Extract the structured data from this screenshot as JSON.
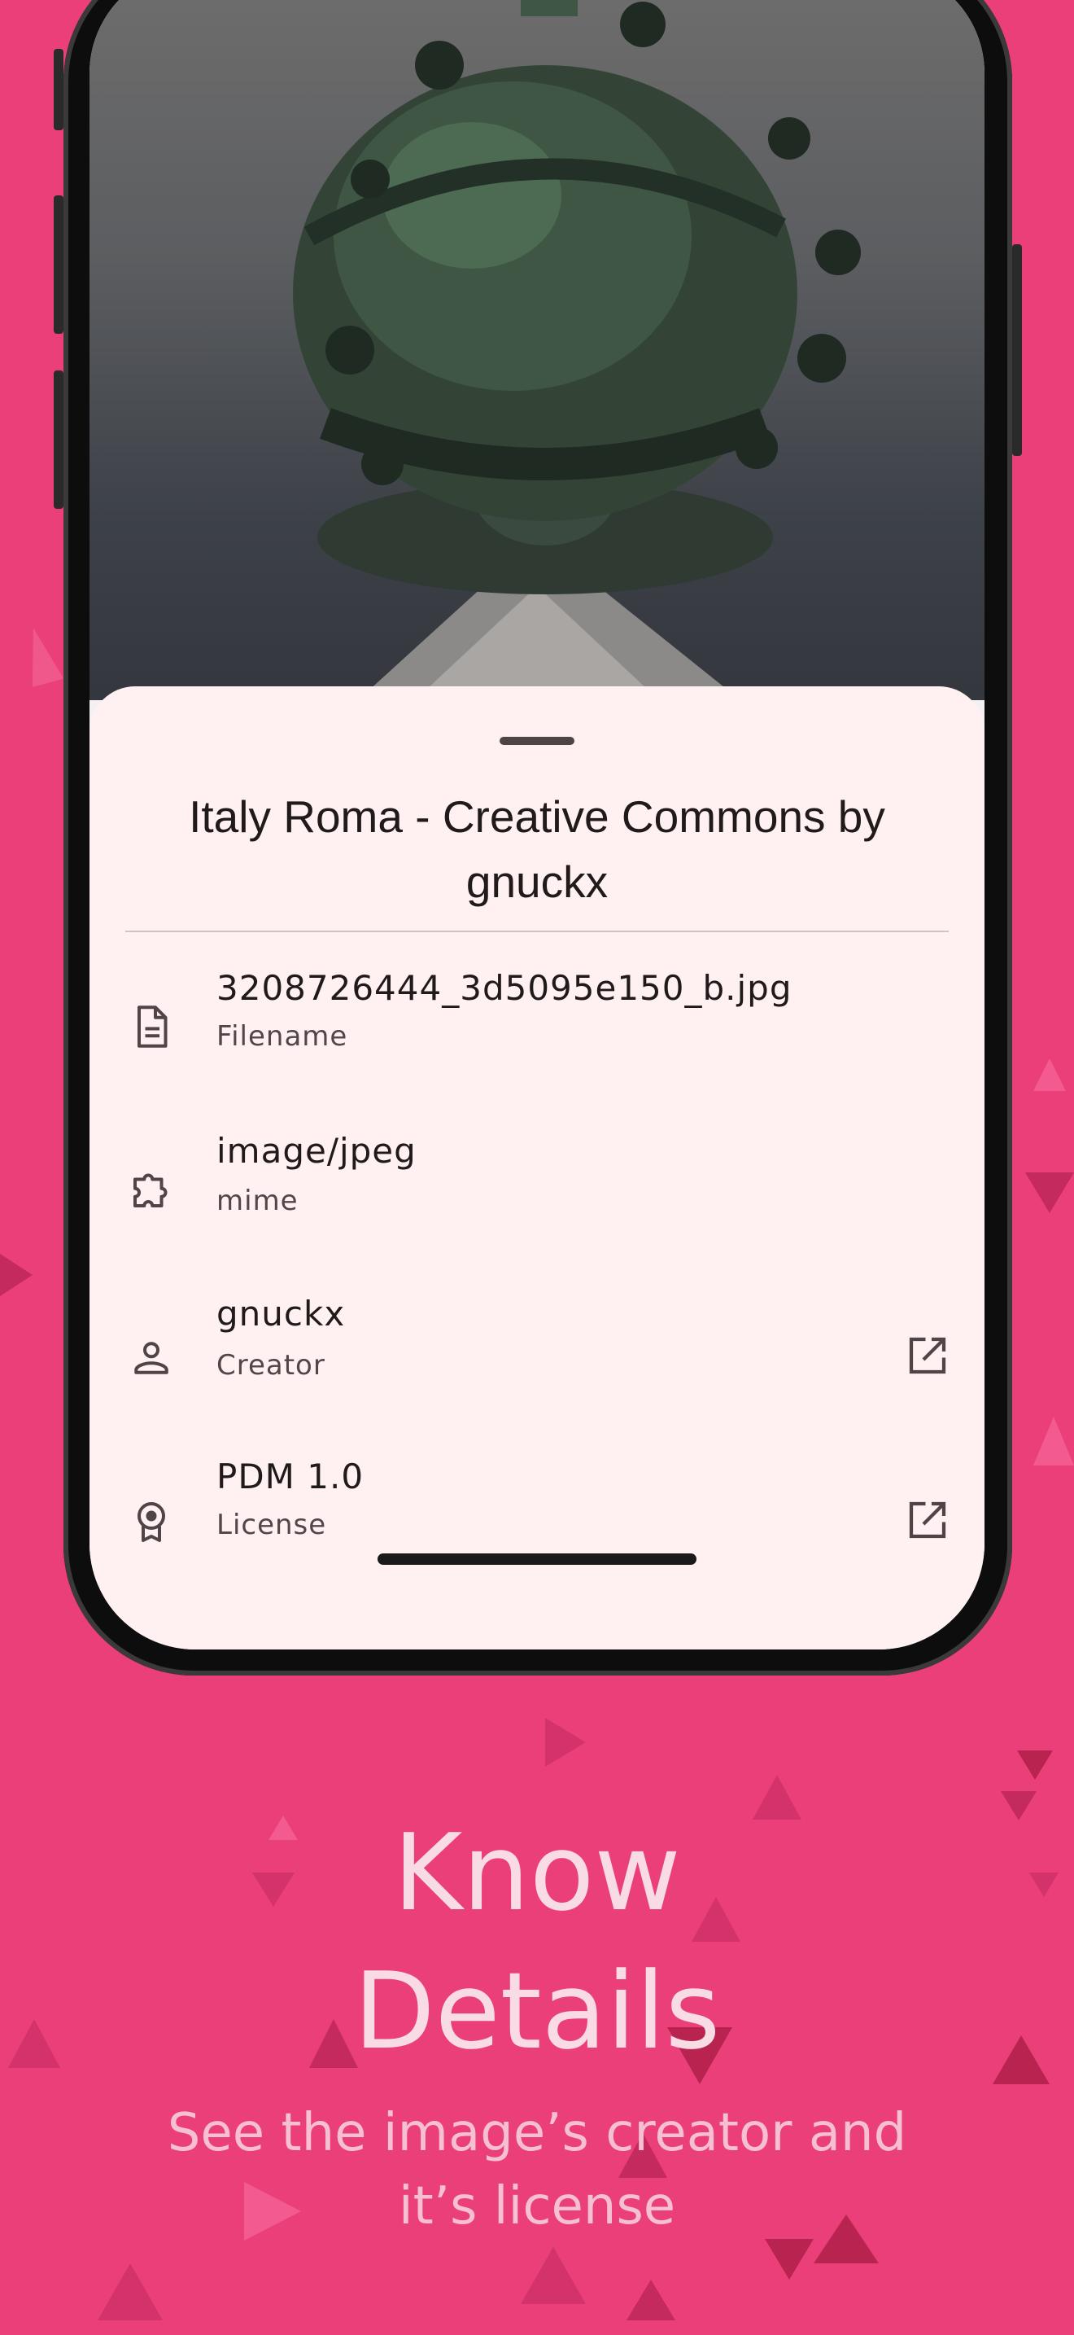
{
  "sheet": {
    "title": "Italy Roma - Creative Commons by gnuckx",
    "items": [
      {
        "icon": "file-icon",
        "value": "3208726444_3d5095e150_b.jpg",
        "label": "Filename",
        "external": false
      },
      {
        "icon": "extension-icon",
        "value": "image/jpeg",
        "label": "mime",
        "external": false
      },
      {
        "icon": "person-icon",
        "value": "gnuckx",
        "label": "Creator",
        "external": true
      },
      {
        "icon": "license-icon",
        "value": "PDM 1.0",
        "label": "License",
        "external": true
      }
    ]
  },
  "promo": {
    "headline_line1": "Know",
    "headline_line2": "Details",
    "subline_line1": "See the image’s creator and",
    "subline_line2": "it’s license"
  },
  "colors": {
    "background": "#ea3f78",
    "sheet": "#fff1f1",
    "headline": "#f9dbe6"
  }
}
